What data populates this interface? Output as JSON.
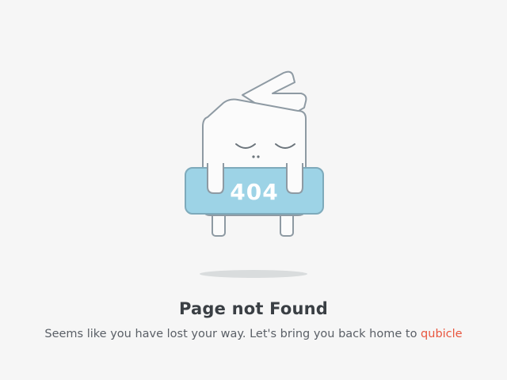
{
  "error": {
    "code": "404",
    "title": "Page not Found",
    "message_prefix": "Seems like you have lost your way. Let's bring you back home to ",
    "home_link_label": "qubicle"
  },
  "colors": {
    "background": "#f6f6f6",
    "title": "#3a3f44",
    "message": "#5a5f66",
    "link_accent": "#e8553e",
    "badge_fill": "#9dd3e6",
    "outline": "#8e9aa3"
  },
  "icons": {
    "mascot": "sleeping-cube-mascot-icon"
  }
}
